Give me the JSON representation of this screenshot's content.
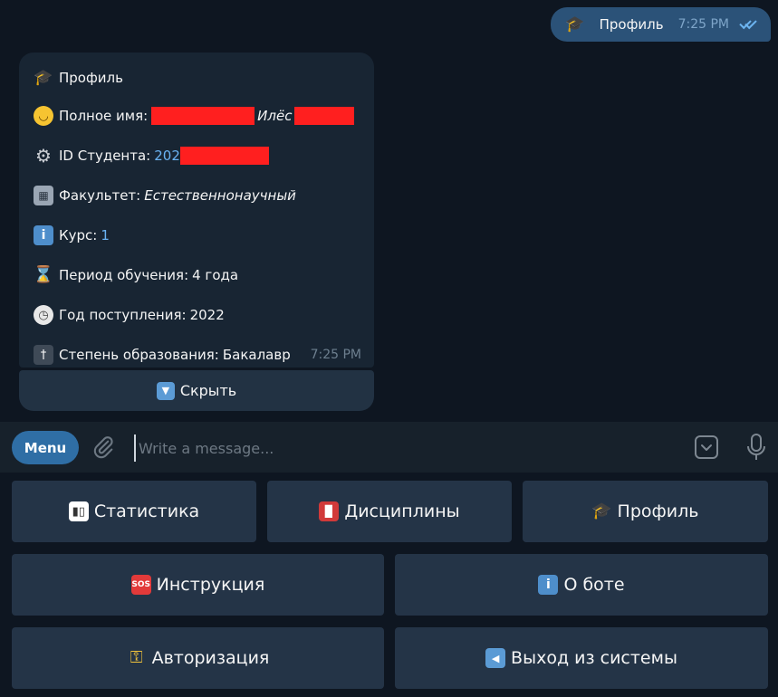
{
  "outgoing": {
    "icon": "graduation-cap-icon",
    "text": "Профиль",
    "time": "7:25 PM",
    "status": "read"
  },
  "profile": {
    "title": "Профиль",
    "full_name_label": "Полное имя:",
    "full_name_visible": "Илёс",
    "student_id_label": "ID Студента:",
    "student_id_visible": "202",
    "faculty_label": "Факультет:",
    "faculty_value": "Естественнонаучный",
    "course_label": "Курс:",
    "course_value": "1",
    "period_label": "Период обучения:",
    "period_value": "4 года",
    "year_label": "Год поступления:",
    "year_value": "2022",
    "degree_label": "Степень образования:",
    "degree_value": "Бакалавр",
    "time": "7:25 PM"
  },
  "inline_button": {
    "label": "Скрыть"
  },
  "composer": {
    "menu_label": "Menu",
    "placeholder": "Write a message..."
  },
  "keyboard": {
    "stats": "Статистика",
    "disciplines": "Дисциплины",
    "profile": "Профиль",
    "instructions": "Инструкция",
    "about": "О боте",
    "auth": "Авторизация",
    "logout": "Выход из системы"
  },
  "colors": {
    "background": "#0e1621",
    "outgoing_bubble": "#2b5278",
    "incoming_bubble": "#182533",
    "button": "#243447",
    "accent": "#2f6ea5",
    "redaction": "#ff1f1f",
    "link": "#6ab3f3"
  }
}
